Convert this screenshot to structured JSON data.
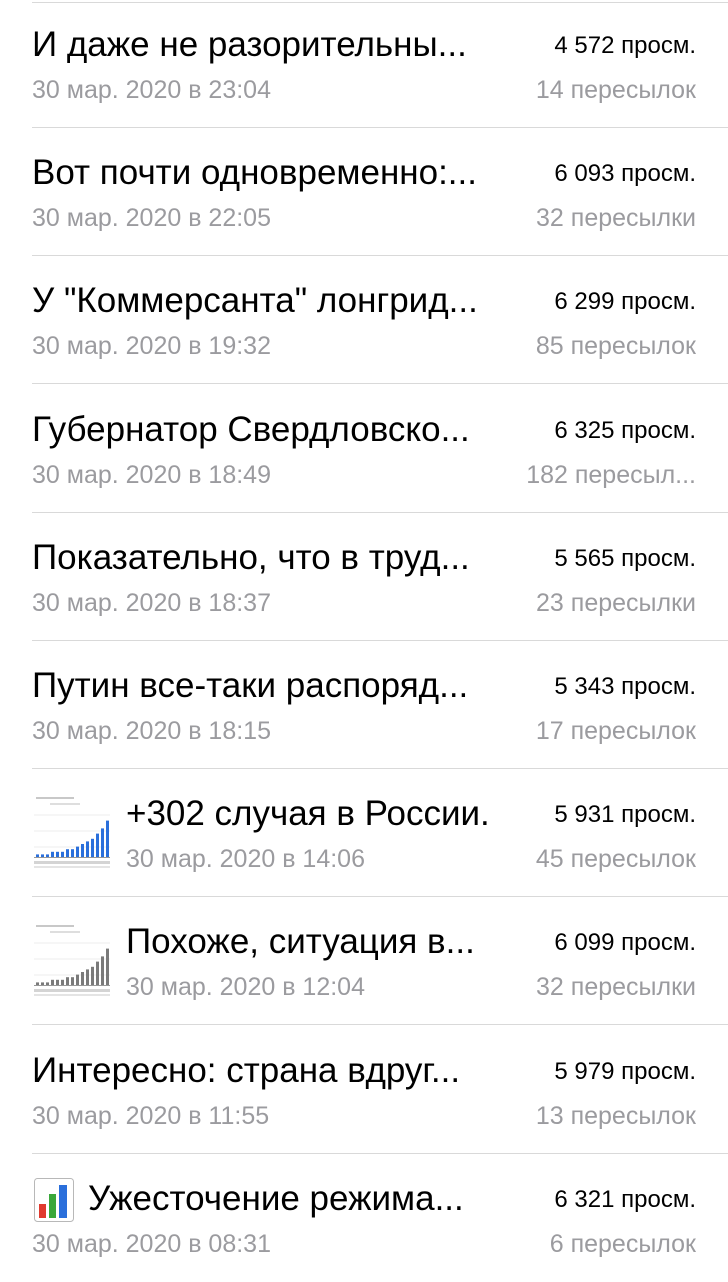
{
  "posts": [
    {
      "title": "И даже не разорительны...",
      "date": "30 мар. 2020 в 23:04",
      "views": "4 572 просм.",
      "forwards": "14 пересылок",
      "media": "none"
    },
    {
      "title": "Вот почти одновременно:...",
      "date": "30 мар. 2020 в 22:05",
      "views": "6 093 просм.",
      "forwards": "32 пересылки",
      "media": "none"
    },
    {
      "title": "У \"Коммерсанта\" лонгрид...",
      "date": "30 мар. 2020 в 19:32",
      "views": "6 299 просм.",
      "forwards": "85 пересылок",
      "media": "none"
    },
    {
      "title": "Губернатор Свердловско...",
      "date": "30 мар. 2020 в 18:49",
      "views": "6 325 просм.",
      "forwards": "182 пересыл...",
      "media": "none"
    },
    {
      "title": "Показательно, что в труд...",
      "date": "30 мар. 2020 в 18:37",
      "views": "5 565 просм.",
      "forwards": "23 пересылки",
      "media": "none"
    },
    {
      "title": "Путин все-таки распоряд...",
      "date": "30 мар. 2020 в 18:15",
      "views": "5 343 просм.",
      "forwards": "17 пересылок",
      "media": "none"
    },
    {
      "title": "+302 случая в России.",
      "date": "30 мар. 2020 в 14:06",
      "views": "5 931 просм.",
      "forwards": "45 пересылок",
      "media": "chart-thumbnail",
      "thumb_accent": "#2a6fdb"
    },
    {
      "title": "Похоже, ситуация в...",
      "date": "30 мар. 2020 в 12:04",
      "views": "6 099 просм.",
      "forwards": "32 пересылки",
      "media": "chart-thumbnail",
      "thumb_accent": "#7a7a7a"
    },
    {
      "title": "Интересно: страна вдруг...",
      "date": "30 мар. 2020 в 11:55",
      "views": "5 979 просм.",
      "forwards": "13 пересылок",
      "media": "none"
    },
    {
      "title": "Ужесточение режима...",
      "date": "30 мар. 2020 в 08:31",
      "views": "6 321 просм.",
      "forwards": "6 пересылок",
      "media": "bar-chart-emoji-icon"
    }
  ],
  "colors": {
    "primary_text": "#000000",
    "secondary_text": "#9b9b9f",
    "separator": "#d9d9d9"
  }
}
